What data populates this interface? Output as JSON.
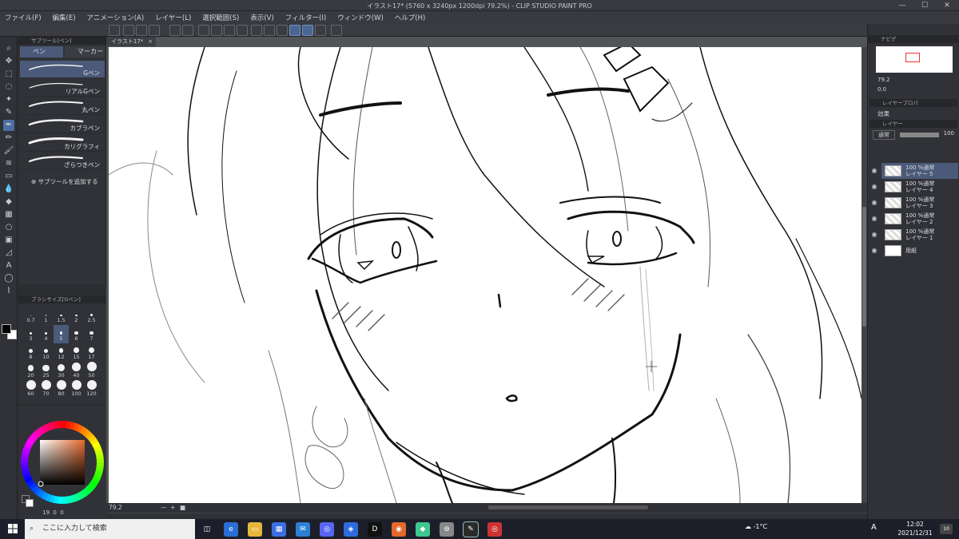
{
  "window": {
    "title": "イラスト17* (5760 x 3240px 1200dpi 79.2%) - CLIP STUDIO PAINT PRO",
    "min": "—",
    "max": "☐",
    "close": "✕"
  },
  "menu": [
    "ファイル(F)",
    "編集(E)",
    "アニメーション(A)",
    "レイヤー(L)",
    "選択範囲(S)",
    "表示(V)",
    "フィルター(I)",
    "ウィンドウ(W)",
    "ヘルプ(H)"
  ],
  "tools": [
    {
      "name": "zoom-tool",
      "glyph": "⌕"
    },
    {
      "name": "move-tool",
      "glyph": "✥"
    },
    {
      "name": "select-tool",
      "glyph": "⬚"
    },
    {
      "name": "lasso-tool",
      "glyph": "◌"
    },
    {
      "name": "wand-tool",
      "glyph": "✦"
    },
    {
      "name": "eyedropper-tool",
      "glyph": "✎"
    },
    {
      "name": "pen-tool",
      "glyph": "✒"
    },
    {
      "name": "pencil-tool",
      "glyph": "✏"
    },
    {
      "name": "brush-tool",
      "glyph": "🖌"
    },
    {
      "name": "airbrush-tool",
      "glyph": "≋"
    },
    {
      "name": "eraser-tool",
      "glyph": "▭"
    },
    {
      "name": "blend-tool",
      "glyph": "💧"
    },
    {
      "name": "fill-tool",
      "glyph": "◆"
    },
    {
      "name": "gradient-tool",
      "glyph": "▦"
    },
    {
      "name": "figure-tool",
      "glyph": "○"
    },
    {
      "name": "frame-tool",
      "glyph": "▣"
    },
    {
      "name": "ruler-tool",
      "glyph": "◿"
    },
    {
      "name": "text-tool",
      "glyph": "A"
    },
    {
      "name": "balloon-tool",
      "glyph": "◯"
    },
    {
      "name": "correct-line-tool",
      "glyph": "⌇"
    }
  ],
  "subtool": {
    "panel_title": "サブツール[ペン]",
    "tab_pen": "ペン",
    "tab_marker": "マーカー",
    "brushes": [
      "Gペン",
      "リアルGペン",
      "丸ペン",
      "カブラペン",
      "カリグラフィ",
      "ざらつきペン"
    ],
    "selected_index": 0,
    "add_label": "サブツールを追加する"
  },
  "brush_size": {
    "panel_title": "ブラシサイズ[Gペン]",
    "sizes": [
      "0.7",
      "1",
      "1.5",
      "2",
      "2.5",
      "3",
      "4",
      "5",
      "6",
      "7",
      "8",
      "10",
      "12",
      "15",
      "17",
      "20",
      "25",
      "30",
      "40",
      "50",
      "60",
      "70",
      "80",
      "100",
      "120"
    ],
    "selected": "5"
  },
  "color": {
    "main": "#000000",
    "sub": "#ffffff",
    "hue_square_hue": "#e56a2c",
    "footer": [
      "19",
      "0",
      "0"
    ]
  },
  "document": {
    "tab_label": "イラスト17*",
    "zoom": "79.2",
    "status_extra": [
      "—",
      "+",
      "■"
    ]
  },
  "navigator": {
    "title": "ナビゲ",
    "zoom": "79.2",
    "rotation": "0.0"
  },
  "layer_property": {
    "title": "レイヤープロパ",
    "effect_label": "効果"
  },
  "layers": {
    "title": "レイヤー",
    "blend_mode": "通常",
    "opacity": "100",
    "items": [
      {
        "opacity": "100 %通常",
        "name": "レイヤー 5",
        "selected": true,
        "paper": false
      },
      {
        "opacity": "100 %通常",
        "name": "レイヤー 4",
        "selected": false,
        "paper": false
      },
      {
        "opacity": "100 %通常",
        "name": "レイヤー 3",
        "selected": false,
        "paper": false
      },
      {
        "opacity": "100 %通常",
        "name": "レイヤー 2",
        "selected": false,
        "paper": false
      },
      {
        "opacity": "100 %通常",
        "name": "レイヤー 1",
        "selected": false,
        "paper": false
      },
      {
        "opacity": "",
        "name": "用紙",
        "selected": false,
        "paper": true
      }
    ]
  },
  "taskbar": {
    "search_placeholder": "ここに入力して検索",
    "apps": [
      "task-view",
      "edge",
      "explorer",
      "store",
      "mail",
      "discord",
      "remote",
      "davinci",
      "firefox-like",
      "app-green",
      "steam-like",
      "clip-studio",
      "media"
    ],
    "weather": "-1°C",
    "ime": "A",
    "time": "12:02",
    "date": "2021/12/31",
    "notifications": "10"
  },
  "accent": "#4b5a79"
}
